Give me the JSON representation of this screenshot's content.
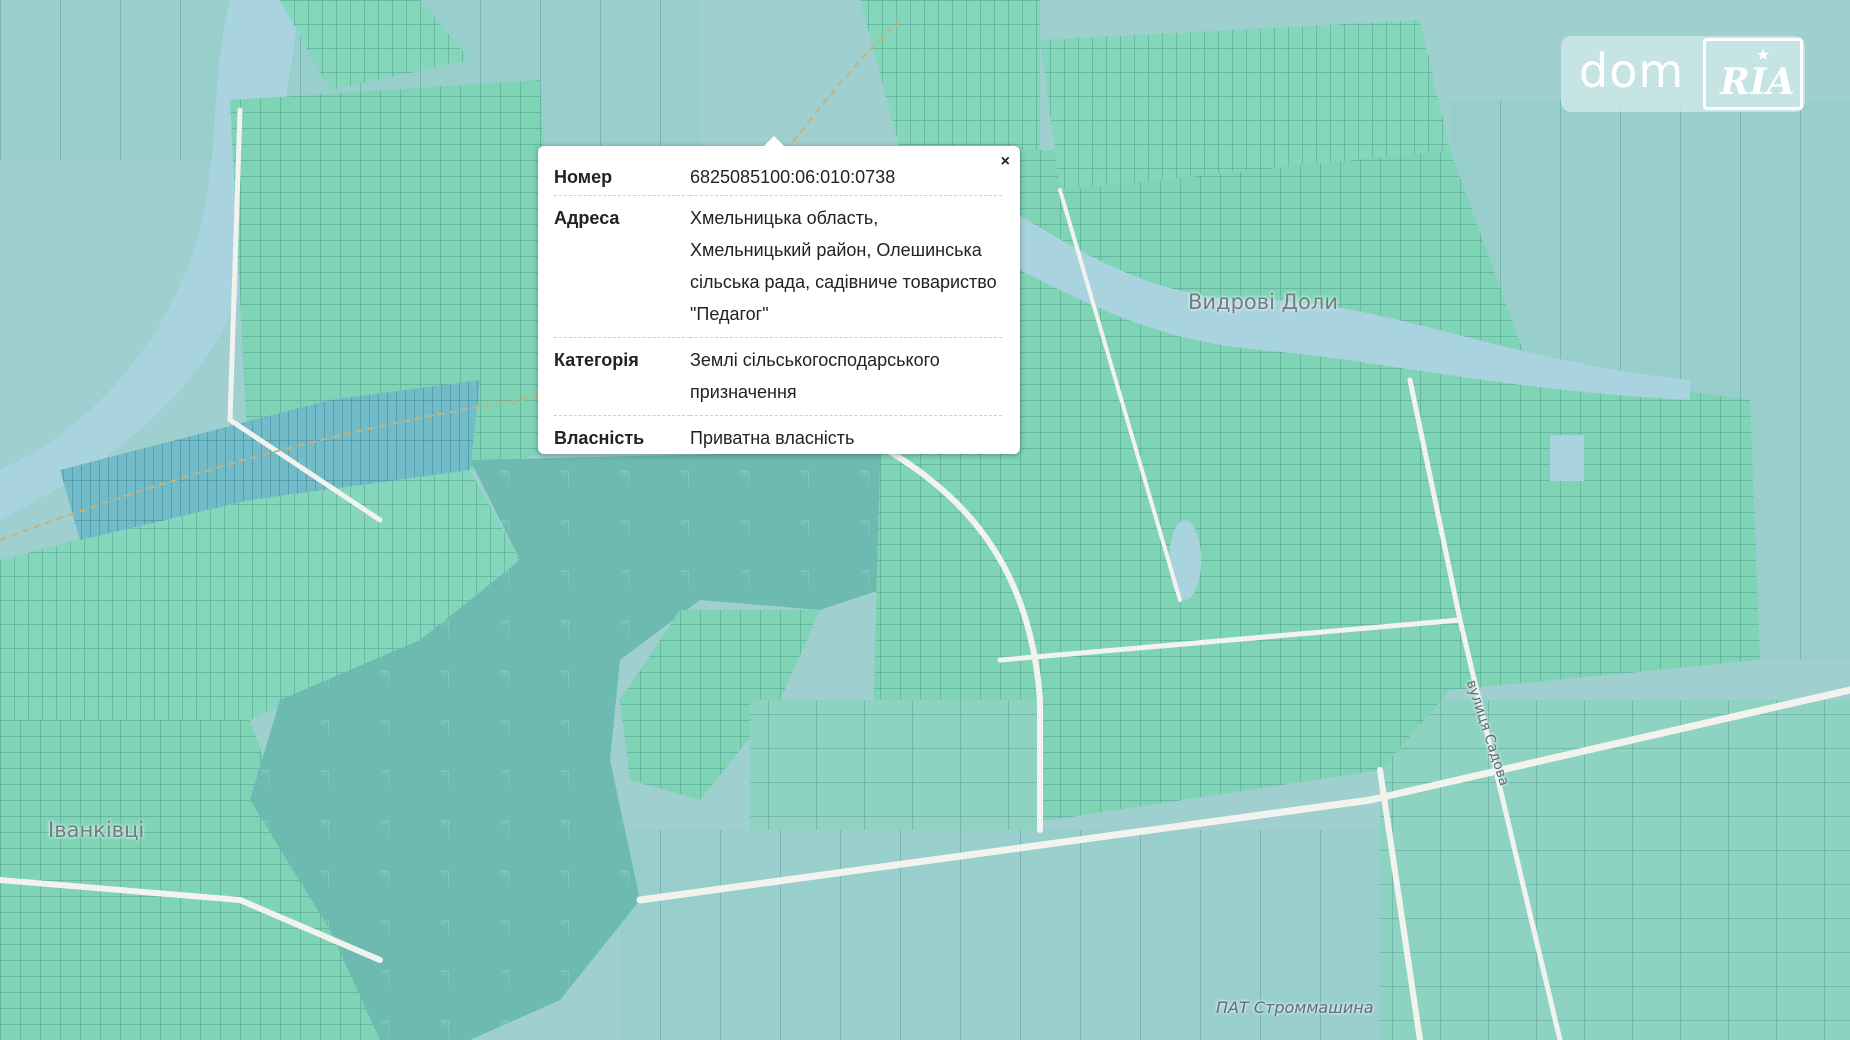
{
  "map": {
    "labels": {
      "village_east": "Видрові Доли",
      "village_west": "Іванківці",
      "company": "ПАТ Строммашина",
      "road": "вулиця Садова"
    },
    "colors": {
      "background": "#9fcfcf",
      "water": "#a9d3de",
      "parcel_light": "#7fd4b6",
      "parcel_blue": "#6fb6c8",
      "forest": "#6dbab0",
      "road": "#f2f2ee"
    }
  },
  "popup": {
    "close_label": "×",
    "rows": [
      {
        "key": "Номер",
        "value": "6825085100:06:010:0738"
      },
      {
        "key": "Адреса",
        "value": "Хмельницька область, Хмельницький район, Олешинська сільська рада, садівниче товариство \"Педагог\""
      },
      {
        "key": "Категорія",
        "value": "Землі сільськогосподарського призначення"
      },
      {
        "key": "Власність",
        "value": "Приватна власність"
      }
    ]
  },
  "logo": {
    "dom": "dom",
    "ria": "RIA"
  }
}
